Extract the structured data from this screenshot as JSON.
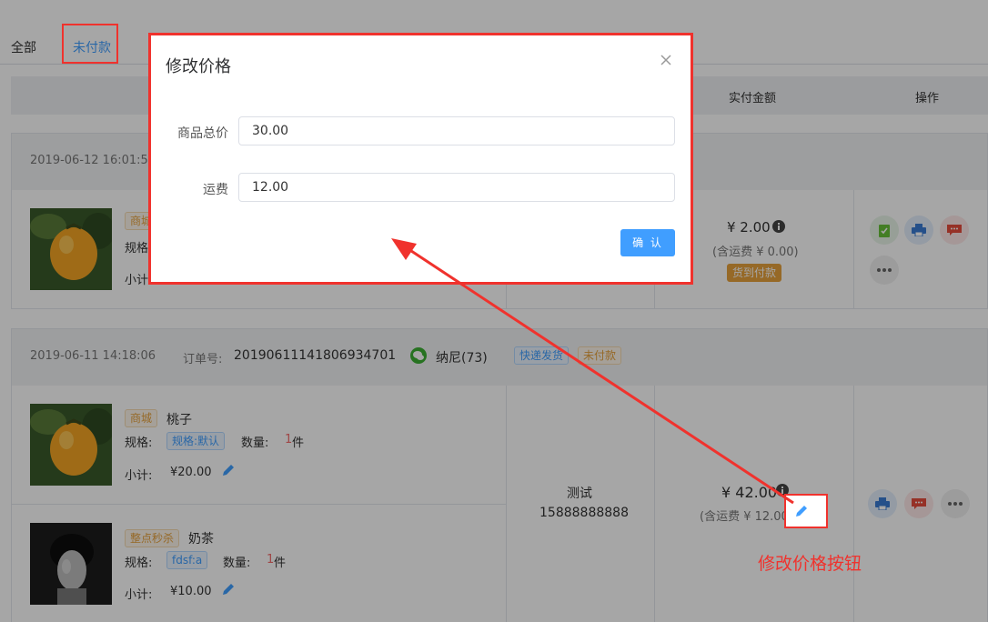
{
  "tabs": [
    {
      "label": "全部"
    },
    {
      "label": "未付款"
    }
  ],
  "table_header": {
    "col_paid": "实付金额",
    "col_action": "操作"
  },
  "order1": {
    "date": "2019-06-12 16:01:5",
    "product_tag": "商城",
    "spec_label": "规格",
    "subtotal_label": "小计",
    "amount": "¥ 2.00",
    "shipping": "(含运费 ¥ 0.00)",
    "badge": "货到付款"
  },
  "order2": {
    "date": "2019-06-11 14:18:06",
    "order_no_label": "订单号:",
    "order_no": "20190611141806934701",
    "buyer": "纳尼(73)",
    "tag_ship": "快递发货",
    "tag_status": "未付款",
    "items": [
      {
        "tag": "商城",
        "name": "桃子",
        "spec_label": "规格:",
        "spec": "规格:默认",
        "qty_label": "数量:",
        "qty": "1",
        "qty_unit": "件",
        "subtotal_label": "小计:",
        "subtotal": "¥20.00"
      },
      {
        "tag": "整点秒杀",
        "name": "奶茶",
        "spec_label": "规格:",
        "spec": "fdsf:a",
        "qty_label": "数量:",
        "qty": "1",
        "qty_unit": "件",
        "subtotal_label": "小计:",
        "subtotal": "¥10.00"
      }
    ],
    "recipient_name": "测试",
    "recipient_phone": "15888888888",
    "amount": "¥ 42.00",
    "shipping": "(含运费 ¥ 12.00)"
  },
  "dialog": {
    "title": "修改价格",
    "field_total_label": "商品总价",
    "field_total_value": "30.00",
    "field_freight_label": "运费",
    "field_freight_value": "12.00",
    "confirm": "确 认"
  },
  "annotation": {
    "text": "修改价格按钮"
  },
  "colors": {
    "accent": "#409eff",
    "annotation_red": "#f0322d",
    "orange_tag": "#e6a23c"
  }
}
